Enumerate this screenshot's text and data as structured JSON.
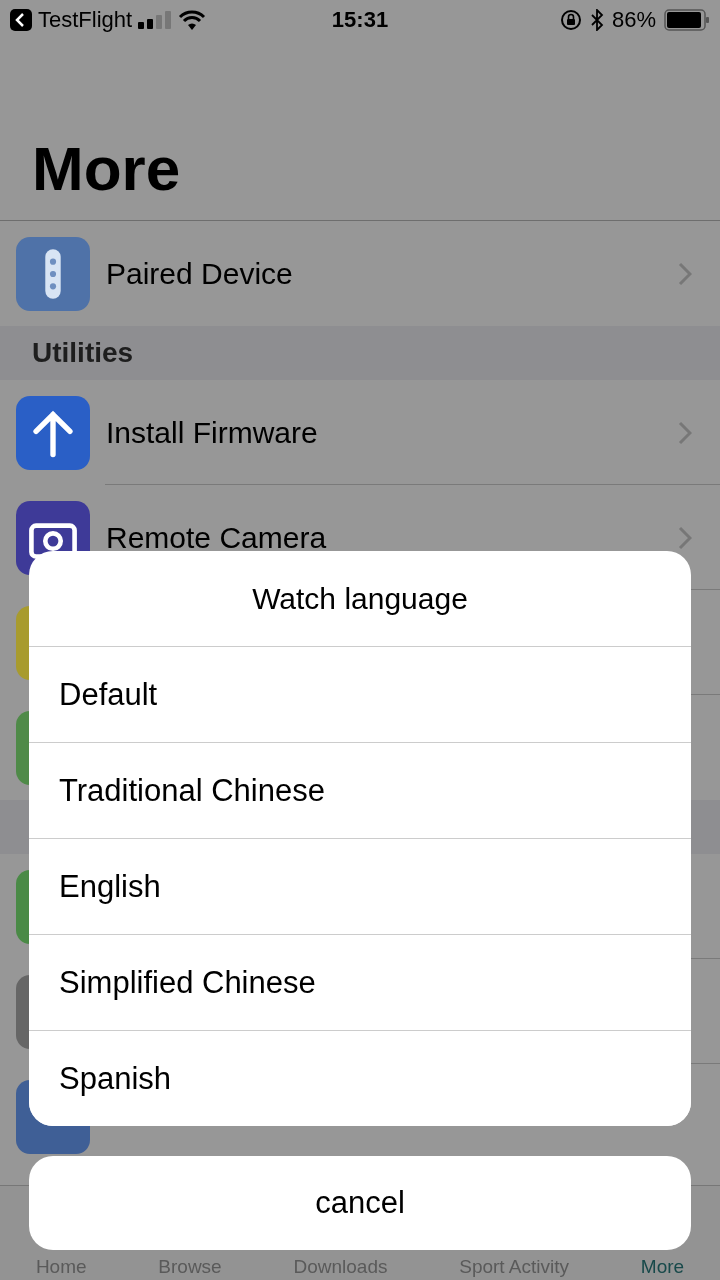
{
  "status_bar": {
    "back_app": "TestFlight",
    "time": "15:31",
    "battery": "86%"
  },
  "title": "More",
  "sections": [
    {
      "rows": [
        {
          "label": "Paired Device",
          "color": "#4f72a8"
        }
      ]
    },
    {
      "header": "Utilities",
      "rows": [
        {
          "label": "Install Firmware",
          "color": "#2a5fc6"
        },
        {
          "label": "Remote Camera",
          "color": "#3e3a98"
        },
        {
          "color": "#a89b2e"
        },
        {
          "color": "#4f8a48"
        }
      ]
    },
    {
      "rows": [
        {
          "color": "#4a8a46"
        },
        {
          "color": "#666666"
        },
        {
          "color": "#3f5f96"
        }
      ]
    }
  ],
  "sheet": {
    "title": "Watch language",
    "options": [
      "Default",
      "Traditional Chinese",
      "English",
      "Simplified Chinese",
      "Spanish"
    ],
    "cancel": "cancel"
  },
  "tabs": [
    {
      "label": "Home",
      "selected": false
    },
    {
      "label": "Browse",
      "selected": false
    },
    {
      "label": "Downloads",
      "selected": false
    },
    {
      "label": "Sport Activity",
      "selected": false
    },
    {
      "label": "More",
      "selected": true
    }
  ]
}
